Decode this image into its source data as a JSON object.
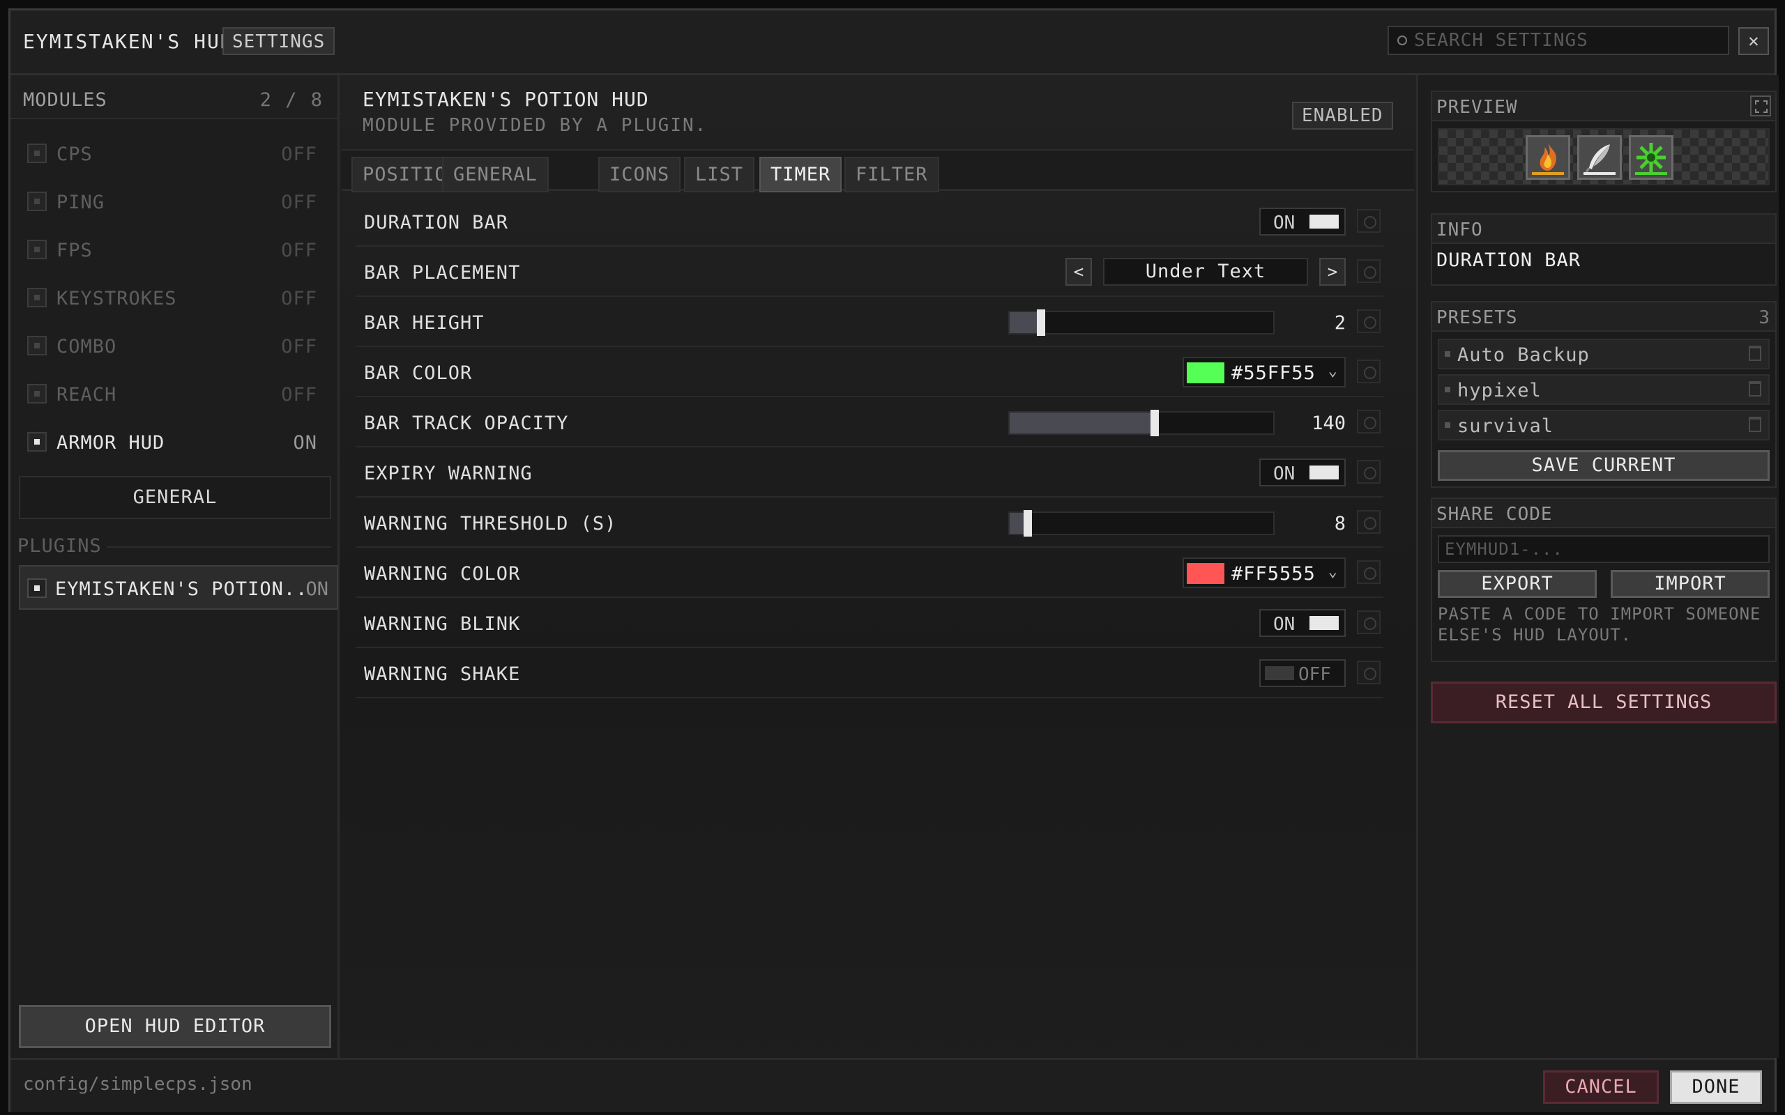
{
  "titlebar": {
    "app_title": "EYMISTAKEN'S HUD",
    "settings_label": "SETTINGS",
    "search_placeholder": "SEARCH SETTINGS",
    "close_glyph": "✕"
  },
  "modules": {
    "title": "MODULES",
    "count": "2 / 8",
    "items": [
      {
        "name": "CPS",
        "state": "OFF"
      },
      {
        "name": "PING",
        "state": "OFF"
      },
      {
        "name": "FPS",
        "state": "OFF"
      },
      {
        "name": "KEYSTROKES",
        "state": "OFF"
      },
      {
        "name": "COMBO",
        "state": "OFF"
      },
      {
        "name": "REACH",
        "state": "OFF"
      },
      {
        "name": "ARMOR HUD",
        "state": "ON"
      }
    ],
    "general_label": "GENERAL",
    "plugins_label": "PLUGINS",
    "plugin": {
      "name": "EYMISTAKEN'S POTION..",
      "state": "ON"
    },
    "open_editor_label": "OPEN HUD EDITOR"
  },
  "module": {
    "title": "EYMISTAKEN'S POTION HUD",
    "subtitle": "MODULE PROVIDED BY A PLUGIN.",
    "status": "ENABLED",
    "tabs": [
      "POSITION",
      "GENERAL",
      "ICONS",
      "LIST",
      "TIMER",
      "FILTER"
    ],
    "active_tab": "TIMER"
  },
  "settings": {
    "duration_bar": {
      "label": "DURATION BAR",
      "state": "ON"
    },
    "bar_placement": {
      "label": "BAR PLACEMENT",
      "value": "Under Text"
    },
    "bar_height": {
      "label": "BAR HEIGHT",
      "value": "2",
      "fraction": 0.12
    },
    "bar_color": {
      "label": "BAR COLOR",
      "value": "#55FF55",
      "color": "#55FF55"
    },
    "bar_track_opacity": {
      "label": "BAR TRACK OPACITY",
      "value": "140",
      "fraction": 0.55
    },
    "expiry_warning": {
      "label": "EXPIRY WARNING",
      "state": "ON"
    },
    "warning_threshold": {
      "label": "WARNING THRESHOLD (S)",
      "value": "8",
      "fraction": 0.07
    },
    "warning_color": {
      "label": "WARNING COLOR",
      "value": "#FF5555",
      "color": "#FF5555"
    },
    "warning_blink": {
      "label": "WARNING BLINK",
      "state": "ON"
    },
    "warning_shake": {
      "label": "WARNING SHAKE",
      "state": "OFF"
    }
  },
  "right": {
    "preview_title": "PREVIEW",
    "preview_icons": [
      "fire-resistance-potion-icon",
      "swiftness-feather-icon",
      "poison-potion-icon"
    ],
    "info_title": "INFO",
    "info_text": "DURATION BAR",
    "presets_title": "PRESETS",
    "presets_count": "3",
    "presets": [
      "Auto Backup",
      "hypixel",
      "survival"
    ],
    "save_current_label": "SAVE CURRENT",
    "share_title": "SHARE CODE",
    "share_placeholder": "EYMHUD1-...",
    "export_label": "EXPORT",
    "import_label": "IMPORT",
    "share_hint": "PASTE A CODE TO IMPORT SOMEONE ELSE'S HUD LAYOUT.",
    "reset_all_label": "RESET ALL SETTINGS"
  },
  "footer": {
    "path": "config/simplecps.json",
    "cancel_label": "CANCEL",
    "done_label": "DONE"
  },
  "colors": {
    "accent_danger": "#3A1E24",
    "slider_fill": "#4A4A52"
  }
}
